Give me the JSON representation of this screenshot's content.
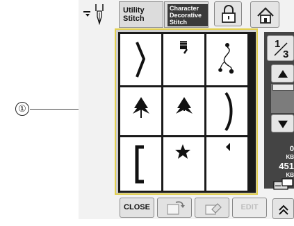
{
  "annotation": {
    "callout_number": "①"
  },
  "header": {
    "tab_utility": [
      "Utility",
      "Stitch"
    ],
    "tab_character": [
      "Character",
      "Decorative",
      "Stitch"
    ]
  },
  "side_panel": {
    "page_indicator": {
      "current": "1",
      "total": "3"
    },
    "memory": [
      {
        "value": "0",
        "unit": "KB"
      },
      {
        "value": "451",
        "unit": "KB"
      }
    ]
  },
  "footer": {
    "close_label": "CLOSE",
    "edit_label": "EDIT"
  },
  "stitch_grid": {
    "cells": [
      "right-bracket-stitch",
      "satin-hook-stitch",
      "swirl-flower-stitch",
      "leaf-left-stitch",
      "leaf-right-stitch",
      "right-parenthesis-stitch",
      "left-bracket-stitch",
      "star-stitch",
      "small-leaf-stitch"
    ]
  },
  "colors": {
    "grid_highlight": "#e2cf4d"
  }
}
